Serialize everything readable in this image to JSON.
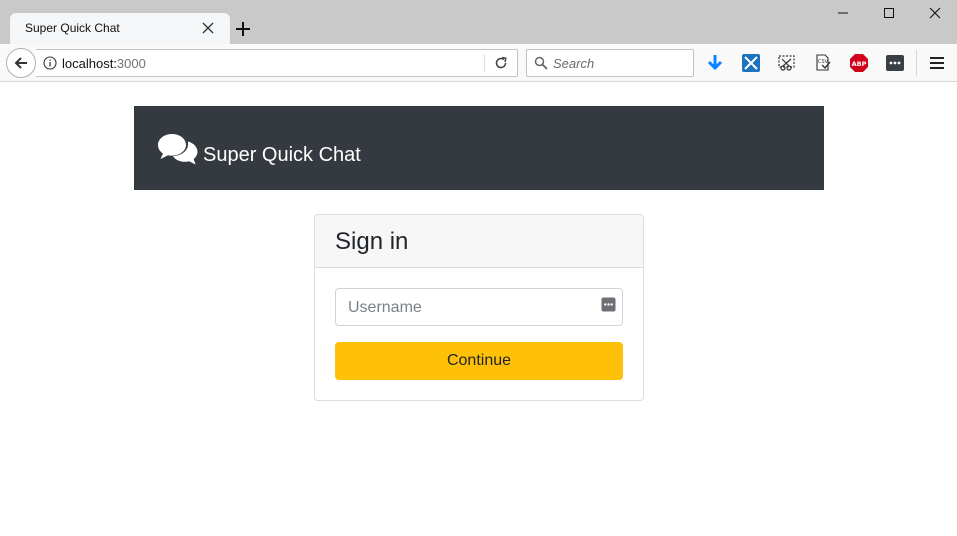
{
  "browser": {
    "tab_title": "Super Quick Chat",
    "url_host": "localhost:",
    "url_port": "3000",
    "search_placeholder": "Search"
  },
  "app": {
    "brand_name": "Super Quick Chat",
    "header_color": "#343a40"
  },
  "signin": {
    "title": "Sign in",
    "username_placeholder": "Username",
    "username_value": "",
    "continue_label": "Continue",
    "button_color": "#ffc107"
  },
  "icons": {
    "tab_close": "close-icon",
    "new_tab": "plus-icon",
    "back": "back-arrow-icon",
    "info": "info-icon",
    "reload": "reload-icon",
    "search": "search-icon",
    "download": "download-arrow-icon",
    "brand": "chat-bubbles-icon",
    "password_manager": "password-manager-icon"
  }
}
